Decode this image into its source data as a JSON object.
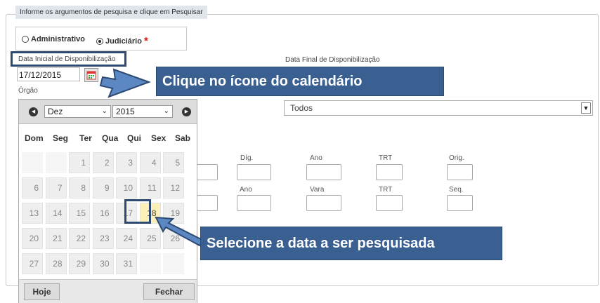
{
  "form": {
    "legend": "Informe os argumentos de pesquisa e clique em Pesquisar",
    "radio_admin": "Administrativo",
    "radio_judicial": "Judiciário",
    "required_mark": "*",
    "label_data_inicial": "Data Inicial de Disponibilização",
    "label_data_final": "Data Final de Disponibilização",
    "data_inicial_value": "17/12/2015",
    "label_orgao": "Órgão",
    "orgao_value": "Todos",
    "row1_labels": [
      "Díg.",
      "Ano",
      "TRT",
      "Orig."
    ],
    "row2_labels": [
      "Ano",
      "Vara",
      "TRT",
      "Seq."
    ]
  },
  "datepicker": {
    "month": "Dez",
    "year": "2015",
    "weekdays": [
      "Dom",
      "Seg",
      "Ter",
      "Qua",
      "Qui",
      "Sex",
      "Sab"
    ],
    "weeks": [
      [
        "",
        "",
        "1",
        "2",
        "3",
        "4",
        "5"
      ],
      [
        "6",
        "7",
        "8",
        "9",
        "10",
        "11",
        "12"
      ],
      [
        "13",
        "14",
        "15",
        "16",
        "17",
        "18",
        "19"
      ],
      [
        "20",
        "21",
        "22",
        "23",
        "24",
        "25",
        "26"
      ],
      [
        "27",
        "28",
        "29",
        "30",
        "31",
        "",
        ""
      ]
    ],
    "today": "18",
    "selected": "17",
    "btn_today": "Hoje",
    "btn_close": "Fechar"
  },
  "callouts": {
    "calendar": "Clique no ícone do calendário",
    "select_date": "Selecione a data a ser pesquisada"
  },
  "colors": {
    "callout_bg": "#3a5f91",
    "highlight_border": "#2d4a73",
    "today_bg": "#fbf0b8",
    "required": "#e01010"
  }
}
